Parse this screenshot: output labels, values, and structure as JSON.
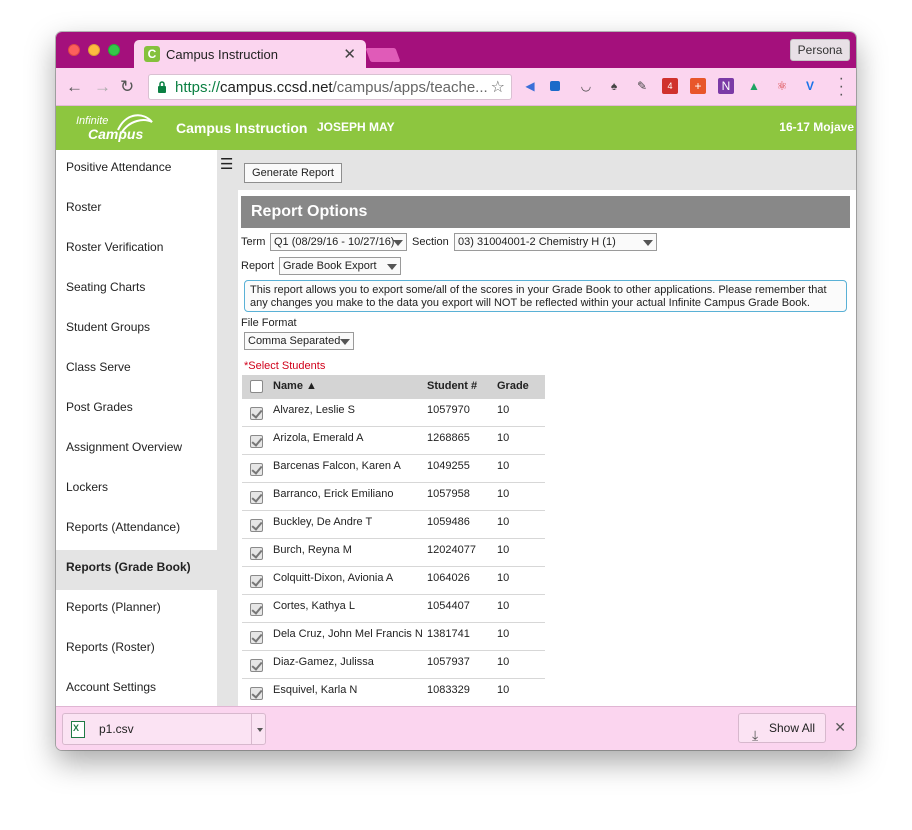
{
  "browser": {
    "tab_title": "Campus Instruction",
    "profile_label": "Persona",
    "url": {
      "scheme": "https://",
      "host": "campus.ccsd.net",
      "path": "/campus/apps/teache..."
    }
  },
  "header": {
    "logo_line1": "Infinite",
    "logo_line2": "Campus",
    "app_name": "Campus Instruction",
    "user_name": "JOSEPH MAY",
    "year_school": "16-17 Mojave"
  },
  "sidebar": {
    "items": [
      {
        "label": "Positive Attendance"
      },
      {
        "label": "Roster"
      },
      {
        "label": "Roster Verification"
      },
      {
        "label": "Seating Charts"
      },
      {
        "label": "Student Groups"
      },
      {
        "label": "Class Serve"
      },
      {
        "label": "Post Grades"
      },
      {
        "label": "Assignment Overview"
      },
      {
        "label": "Lockers"
      },
      {
        "label": "Reports (Attendance)"
      },
      {
        "label": "Reports (Grade Book)"
      },
      {
        "label": "Reports (Planner)"
      },
      {
        "label": "Reports (Roster)"
      },
      {
        "label": "Account Settings"
      }
    ],
    "active_index": 10
  },
  "toolbar": {
    "generate_label": "Generate Report"
  },
  "report": {
    "title": "Report Options",
    "term_label": "Term",
    "term_value": "Q1 (08/29/16 - 10/27/16)",
    "section_label": "Section",
    "section_value": "03) 31004001-2 Chemistry H (1)",
    "report_label": "Report",
    "report_value": "Grade Book Export",
    "info_text": "This report allows you to export some/all of the scores in your Grade Book to other applications. Please remember that any changes you make to the data you export will NOT be reflected within your actual Infinite Campus Grade Book.",
    "file_format_label": "File Format",
    "file_format_value": "Comma Separated",
    "select_students_label": "*Select Students"
  },
  "students": {
    "columns": {
      "name": "Name",
      "student_num": "Student #",
      "grade": "Grade"
    },
    "rows": [
      {
        "name": "Alvarez, Leslie S",
        "student_num": "1057970",
        "grade": "10"
      },
      {
        "name": "Arizola, Emerald A",
        "student_num": "1268865",
        "grade": "10"
      },
      {
        "name": "Barcenas Falcon, Karen A",
        "student_num": "1049255",
        "grade": "10"
      },
      {
        "name": "Barranco, Erick Emiliano",
        "student_num": "1057958",
        "grade": "10"
      },
      {
        "name": "Buckley, De Andre T",
        "student_num": "1059486",
        "grade": "10"
      },
      {
        "name": "Burch, Reyna M",
        "student_num": "12024077",
        "grade": "10"
      },
      {
        "name": "Colquitt-Dixon, Avionia A",
        "student_num": "1064026",
        "grade": "10"
      },
      {
        "name": "Cortes, Kathya L",
        "student_num": "1054407",
        "grade": "10"
      },
      {
        "name": "Dela Cruz, John Mel Francis N",
        "student_num": "1381741",
        "grade": "10"
      },
      {
        "name": "Diaz-Gamez, Julissa",
        "student_num": "1057937",
        "grade": "10"
      },
      {
        "name": "Esquivel, Karla N",
        "student_num": "1083329",
        "grade": "10"
      }
    ]
  },
  "downloads": {
    "file_name": "p1.csv",
    "show_all_label": "Show All"
  }
}
